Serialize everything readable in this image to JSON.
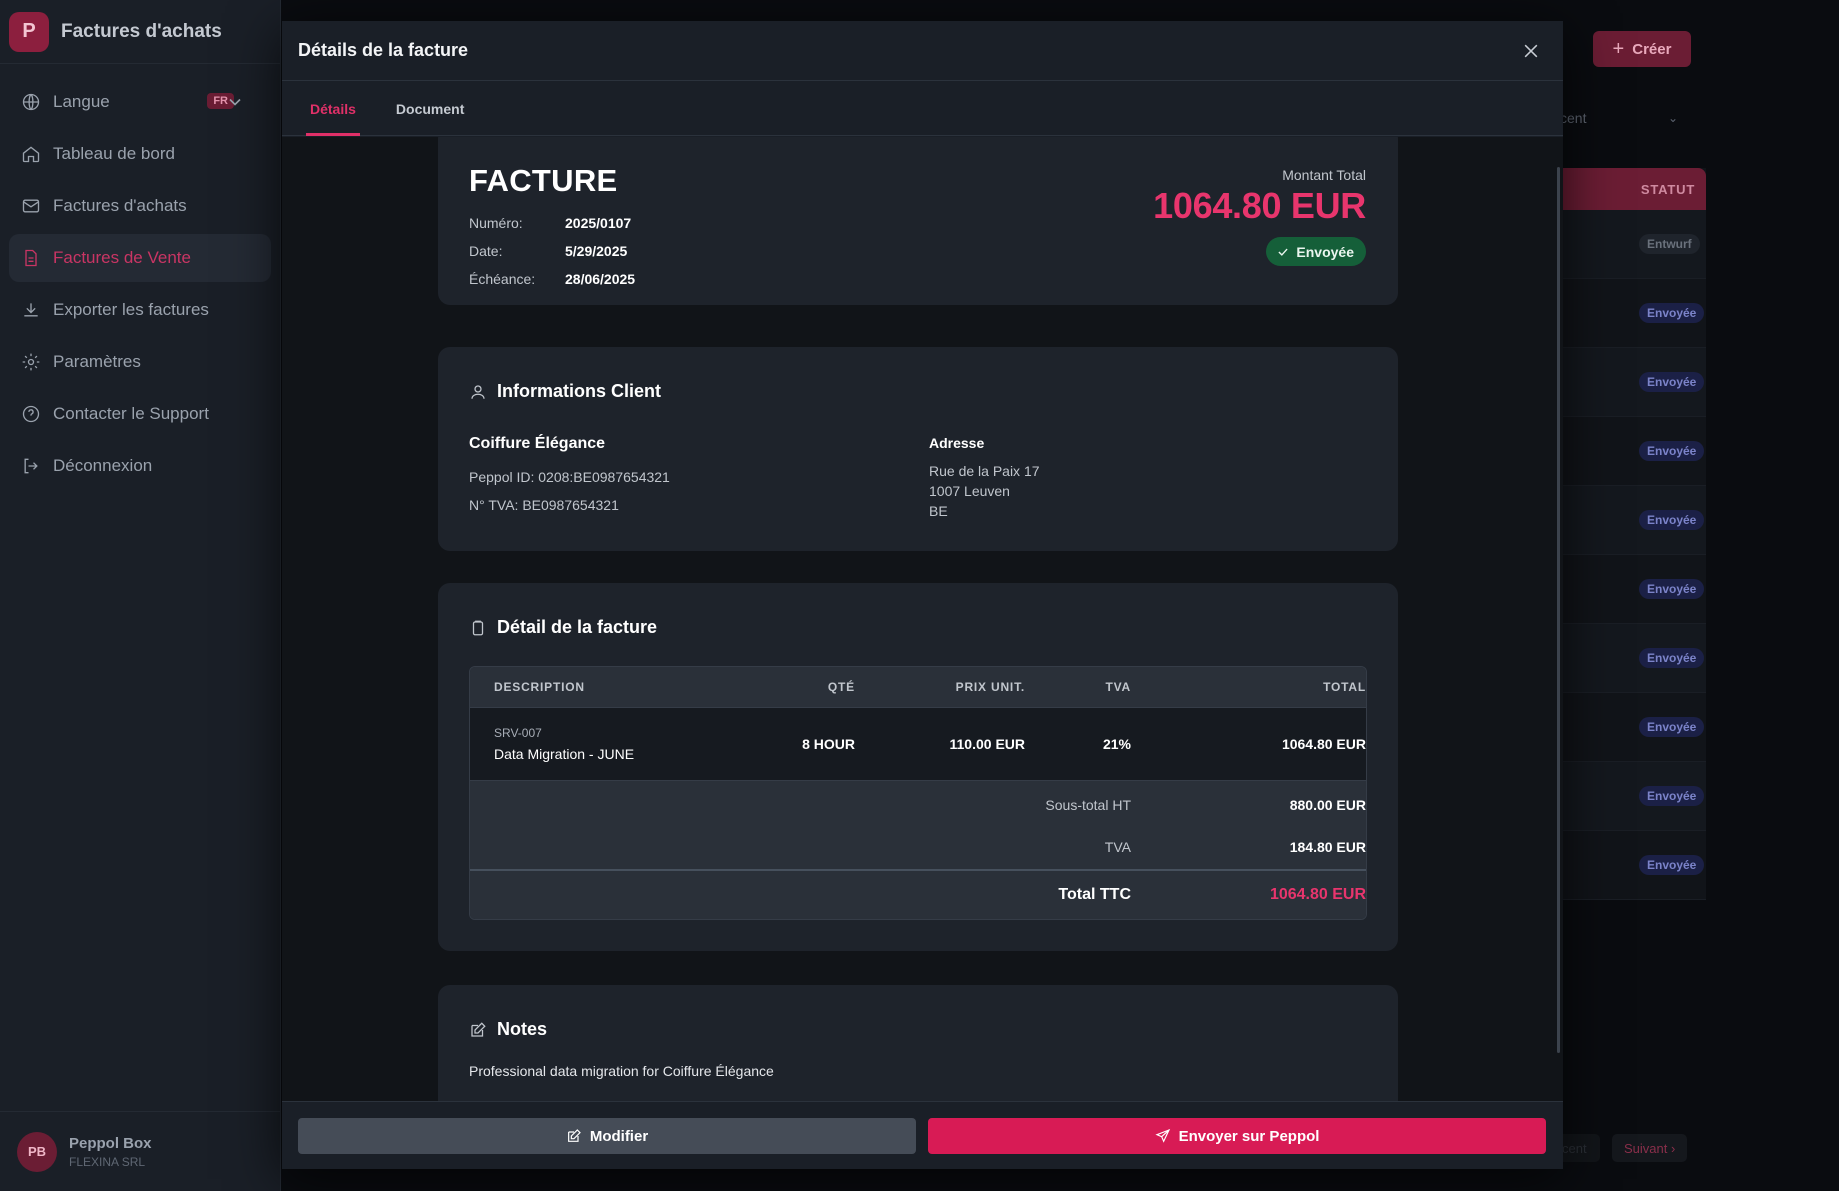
{
  "sidebar": {
    "logo_letter": "P",
    "app_title": "Factures d'achats",
    "items": [
      {
        "label": "Langue",
        "icon": "globe-icon",
        "badge": "FR"
      },
      {
        "label": "Tableau de bord",
        "icon": "home-icon"
      },
      {
        "label": "Factures d'achats",
        "icon": "mail-icon"
      },
      {
        "label": "Factures de Vente",
        "icon": "document-icon",
        "active": true
      },
      {
        "label": "Exporter les factures",
        "icon": "download-icon"
      },
      {
        "label": "Paramètres",
        "icon": "gear-icon"
      },
      {
        "label": "Contacter le Support",
        "icon": "help-icon"
      },
      {
        "label": "Déconnexion",
        "icon": "logout-icon"
      }
    ],
    "user": {
      "initials": "PB",
      "name": "Peppol Box",
      "company": "FLEXINA SRL"
    }
  },
  "background": {
    "create_label": "Créer",
    "filter_value": "cent",
    "status_header": "STATUT",
    "statuses": [
      "Entwurf",
      "Envoyée",
      "Envoyée",
      "Envoyée",
      "Envoyée",
      "Envoyée",
      "Envoyée",
      "Envoyée",
      "Envoyée",
      "Envoyée"
    ],
    "next_label": "Suivant",
    "prev_label": "cent"
  },
  "modal": {
    "title": "Détails de la facture",
    "tabs": [
      {
        "label": "Détails",
        "active": true
      },
      {
        "label": "Document"
      }
    ],
    "invoice": {
      "heading": "FACTURE",
      "number_label": "Numéro:",
      "number": "2025/0107",
      "date_label": "Date:",
      "date": "5/29/2025",
      "due_label": "Échéance:",
      "due": "28/06/2025",
      "total_label": "Montant Total",
      "total": "1064.80 EUR",
      "status": "Envoyée"
    },
    "client": {
      "section_title": "Informations Client",
      "name": "Coiffure Élégance",
      "peppol": "Peppol ID: 0208:BE0987654321",
      "vat": "N° TVA: BE0987654321",
      "address_title": "Adresse",
      "address_lines": [
        "Rue de la Paix 17",
        "1007 Leuven",
        "BE"
      ]
    },
    "details": {
      "section_title": "Détail de la facture",
      "headers": {
        "description": "DESCRIPTION",
        "qty": "QTÉ",
        "price": "PRIX UNIT.",
        "vat": "TVA",
        "total": "TOTAL"
      },
      "rows": [
        {
          "sku": "SRV-007",
          "description": "Data Migration - JUNE",
          "qty": "8 HOUR",
          "price": "110.00 EUR",
          "vat": "21%",
          "total": "1064.80 EUR"
        }
      ],
      "subtotal_label": "Sous-total HT",
      "subtotal": "880.00 EUR",
      "vat_label": "TVA",
      "vat_amount": "184.80 EUR",
      "grand_total_label": "Total TTC",
      "grand_total": "1064.80 EUR"
    },
    "notes": {
      "section_title": "Notes",
      "text": "Professional data migration for Coiffure Élégance"
    },
    "footer": {
      "edit_label": "Modifier",
      "send_label": "Envoyer sur Peppol"
    }
  },
  "colors": {
    "accent": "#e8356d",
    "primary_button": "#d81b55",
    "success": "#155f39",
    "sidebar_bg": "#1a1f27"
  }
}
